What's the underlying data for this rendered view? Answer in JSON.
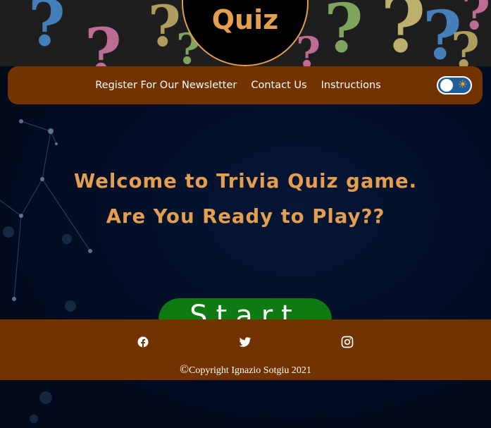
{
  "hero": {
    "logo_text": "Quiz"
  },
  "nav": {
    "links": [
      "Register For Our Newsletter",
      "Contact Us",
      "Instructions"
    ],
    "theme_toggle_icon": "sun-icon"
  },
  "welcome": {
    "line1": "Welcome to Trivia Quiz game.",
    "line2": "Are You Ready to Play??"
  },
  "start_button": {
    "label": "Start"
  },
  "footer": {
    "social_icons": [
      "facebook-icon",
      "twitter-icon",
      "instagram-icon"
    ],
    "copyright_symbol": "©",
    "copyright_text": "Copyright Ignazio Sotgiu 2021"
  },
  "colors": {
    "brown": "#733300",
    "accent": "#e49e4f",
    "green": "#0f7a12",
    "background": "#03102a"
  }
}
